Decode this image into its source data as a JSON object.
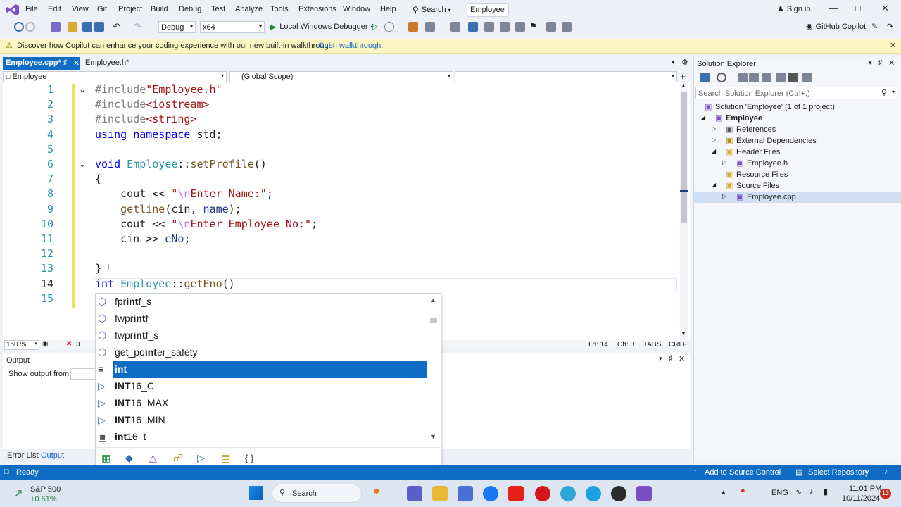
{
  "menubar": {
    "items": [
      "File",
      "Edit",
      "View",
      "Git",
      "Project",
      "Build",
      "Debug",
      "Test",
      "Analyze",
      "Tools",
      "Extensions",
      "Window",
      "Help"
    ],
    "search_label": "Search",
    "solution_title": "Employee",
    "signin_label": "Sign in"
  },
  "toolbar": {
    "config": "Debug",
    "platform": "x64",
    "debugger": "Local Windows Debugger",
    "copilot_label": "GitHub Copilot"
  },
  "infobar": {
    "message": "Discover how Copilot can enhance your coding experience with our new built-in walkthrough!",
    "link": "Open walkthrough."
  },
  "tabs": [
    {
      "label": "Employee.cpp*",
      "active": true
    },
    {
      "label": "Employee.h*",
      "active": false
    }
  ],
  "navbar": {
    "project": "Employee",
    "scope": "(Global Scope)"
  },
  "editor": {
    "line_numbers": [
      "1",
      "2",
      "3",
      "4",
      "5",
      "6",
      "7",
      "8",
      "9",
      "10",
      "11",
      "12",
      "13",
      "14",
      "15"
    ],
    "lines": [
      [
        {
          "t": "#include",
          "c": "pp"
        },
        {
          "t": "\"Employee.h\"",
          "c": "str"
        }
      ],
      [
        {
          "t": "#include",
          "c": "pp"
        },
        {
          "t": "<iostream>",
          "c": "str"
        }
      ],
      [
        {
          "t": "#include",
          "c": "pp"
        },
        {
          "t": "<string>",
          "c": "str"
        }
      ],
      [
        {
          "t": "using",
          "c": "kw"
        },
        {
          "t": " ",
          "c": "ns"
        },
        {
          "t": "namespace",
          "c": "kw"
        },
        {
          "t": " std;",
          "c": "ns"
        }
      ],
      [],
      [
        {
          "t": "void",
          "c": "kw"
        },
        {
          "t": " ",
          "c": "ns"
        },
        {
          "t": "Employee",
          "c": "ty"
        },
        {
          "t": "::",
          "c": "ns"
        },
        {
          "t": "setProfile",
          "c": "fn"
        },
        {
          "t": "()",
          "c": "ns"
        }
      ],
      [
        {
          "t": "{",
          "c": "ns"
        }
      ],
      [
        {
          "t": "    cout ",
          "c": "ns"
        },
        {
          "t": "<<",
          "c": "ns"
        },
        {
          "t": " \"",
          "c": "str"
        },
        {
          "t": "\\n",
          "c": "esc"
        },
        {
          "t": "Enter Name:\"",
          "c": "str"
        },
        {
          "t": ";",
          "c": "ns"
        }
      ],
      [
        {
          "t": "    ",
          "c": "ns"
        },
        {
          "t": "getline",
          "c": "fn"
        },
        {
          "t": "(cin, ",
          "c": "ns"
        },
        {
          "t": "name",
          "c": "var"
        },
        {
          "t": ");",
          "c": "ns"
        }
      ],
      [
        {
          "t": "    cout ",
          "c": "ns"
        },
        {
          "t": "<<",
          "c": "ns"
        },
        {
          "t": " \"",
          "c": "str"
        },
        {
          "t": "\\n",
          "c": "esc"
        },
        {
          "t": "Enter Employee No:\"",
          "c": "str"
        },
        {
          "t": ";",
          "c": "ns"
        }
      ],
      [
        {
          "t": "    cin ",
          "c": "ns"
        },
        {
          "t": ">>",
          "c": "ns"
        },
        {
          "t": " ",
          "c": "ns"
        },
        {
          "t": "eNo",
          "c": "var"
        },
        {
          "t": ";",
          "c": "ns"
        }
      ],
      [],
      [
        {
          "t": "}",
          "c": "ns"
        }
      ],
      [
        {
          "t": "int",
          "c": "kw"
        },
        {
          "t": " ",
          "c": "ns"
        },
        {
          "t": "Employee",
          "c": "ty"
        },
        {
          "t": "::",
          "c": "ns"
        },
        {
          "t": "getEno",
          "c": "fn"
        },
        {
          "t": "()",
          "c": "ns"
        }
      ],
      []
    ]
  },
  "completion": {
    "items": [
      {
        "pre": "fpr",
        "bold": "int",
        "post": "f_s",
        "icon": "cube",
        "selected": false
      },
      {
        "pre": "fwpr",
        "bold": "int",
        "post": "f",
        "icon": "cube",
        "selected": false
      },
      {
        "pre": "fwpr",
        "bold": "int",
        "post": "f_s",
        "icon": "cube",
        "selected": false
      },
      {
        "pre": "get_po",
        "bold": "int",
        "post": "er_safety",
        "icon": "cube",
        "selected": false
      },
      {
        "pre": "",
        "bold": "int",
        "post": "",
        "icon": "keyword",
        "selected": true
      },
      {
        "pre": "",
        "bold": "INT",
        "post": "16_C",
        "icon": "macro",
        "selected": false
      },
      {
        "pre": "",
        "bold": "INT",
        "post": "16_MAX",
        "icon": "macro",
        "selected": false
      },
      {
        "pre": "",
        "bold": "INT",
        "post": "16_MIN",
        "icon": "macro",
        "selected": false
      },
      {
        "pre": "",
        "bold": "int",
        "post": "16_t",
        "icon": "typedef",
        "selected": false
      }
    ],
    "filter_icons": [
      "all-icon",
      "class-icon",
      "cube-icon",
      "link-icon",
      "macro-icon",
      "struct-icon",
      "braces-icon"
    ],
    "braces": "{ }"
  },
  "editor_status": {
    "zoom": "150 %",
    "errors": "3",
    "line": "Ln: 14",
    "col": "Ch: 3",
    "indent": "TABS",
    "eol": "CRLF"
  },
  "output": {
    "title": "Output",
    "show_from": "Show output from:",
    "tabs": [
      "Error List",
      "Output"
    ]
  },
  "solution_explorer": {
    "title": "Solution Explorer",
    "search_placeholder": "Search Solution Explorer (Ctrl+;)",
    "tree": [
      {
        "label": "Solution 'Employee' (1 of 1 project)",
        "depth": 0,
        "bold": false
      },
      {
        "label": "Employee",
        "depth": 1,
        "bold": true
      },
      {
        "label": "References",
        "depth": 2,
        "bold": false
      },
      {
        "label": "External Dependencies",
        "depth": 2,
        "bold": false
      },
      {
        "label": "Header Files",
        "depth": 2,
        "bold": false
      },
      {
        "label": "Employee.h",
        "depth": 3,
        "bold": false
      },
      {
        "label": "Resource Files",
        "depth": 2,
        "bold": false
      },
      {
        "label": "Source Files",
        "depth": 2,
        "bold": false
      },
      {
        "label": "Employee.cpp",
        "depth": 3,
        "bold": false,
        "selected": true
      }
    ]
  },
  "statusbar": {
    "ready": "Ready",
    "source_control": "Add to Source Control",
    "repository": "Select Repository",
    "notif_count": ""
  },
  "taskbar": {
    "stock_name": "S&P 500",
    "stock_change": "+0.51%",
    "search": "Search",
    "lang": "ENG",
    "time": "11:01 PM",
    "date": "10/11/2024",
    "badge": "13"
  }
}
